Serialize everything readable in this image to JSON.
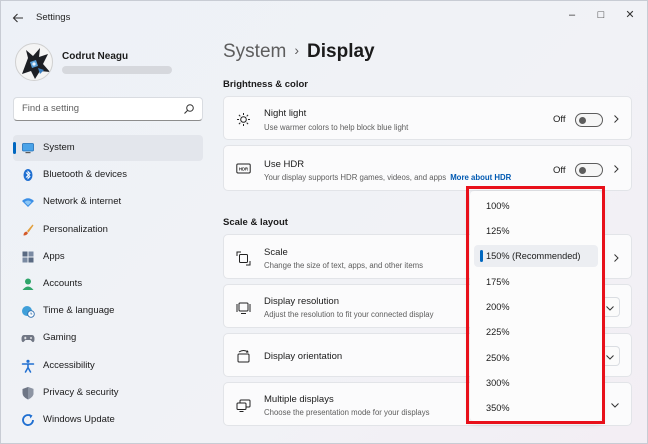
{
  "window": {
    "title": "Settings",
    "controls": {
      "minimize": "–",
      "maximize": "□",
      "close": "✕"
    }
  },
  "profile": {
    "name": "Codrut Neagu"
  },
  "search": {
    "placeholder": "Find a setting"
  },
  "sidebar": {
    "items": [
      {
        "label": "System",
        "icon": "system-icon",
        "active": true
      },
      {
        "label": "Bluetooth & devices",
        "icon": "bluetooth-icon"
      },
      {
        "label": "Network & internet",
        "icon": "wifi-icon"
      },
      {
        "label": "Personalization",
        "icon": "brush-icon"
      },
      {
        "label": "Apps",
        "icon": "apps-icon"
      },
      {
        "label": "Accounts",
        "icon": "accounts-icon"
      },
      {
        "label": "Time & language",
        "icon": "globe-clock-icon"
      },
      {
        "label": "Gaming",
        "icon": "gamepad-icon"
      },
      {
        "label": "Accessibility",
        "icon": "accessibility-icon"
      },
      {
        "label": "Privacy & security",
        "icon": "shield-icon"
      },
      {
        "label": "Windows Update",
        "icon": "update-icon"
      }
    ]
  },
  "header": {
    "parent": "System",
    "separator": "›",
    "current": "Display"
  },
  "sections": {
    "brightness": "Brightness & color",
    "scale_layout": "Scale & layout"
  },
  "cards": {
    "night_light": {
      "title": "Night light",
      "desc": "Use warmer colors to help block blue light",
      "state": "Off"
    },
    "hdr": {
      "title": "Use HDR",
      "desc": "Your display supports HDR games, videos, and apps",
      "link": "More about HDR",
      "state": "Off"
    },
    "scale": {
      "title": "Scale",
      "desc": "Change the size of text, apps, and other items"
    },
    "resolution": {
      "title": "Display resolution",
      "desc": "Adjust the resolution to fit your connected display"
    },
    "orientation": {
      "title": "Display orientation"
    },
    "multiple": {
      "title": "Multiple displays",
      "desc": "Choose the presentation mode for your displays"
    }
  },
  "scale_dropdown": {
    "selected": "150% (Recommended)",
    "options": [
      "100%",
      "125%",
      "150% (Recommended)",
      "175%",
      "200%",
      "225%",
      "250%",
      "300%",
      "350%"
    ]
  },
  "colors": {
    "accent": "#0067c0",
    "link": "#0059b2",
    "highlight_border": "#e8101a"
  }
}
